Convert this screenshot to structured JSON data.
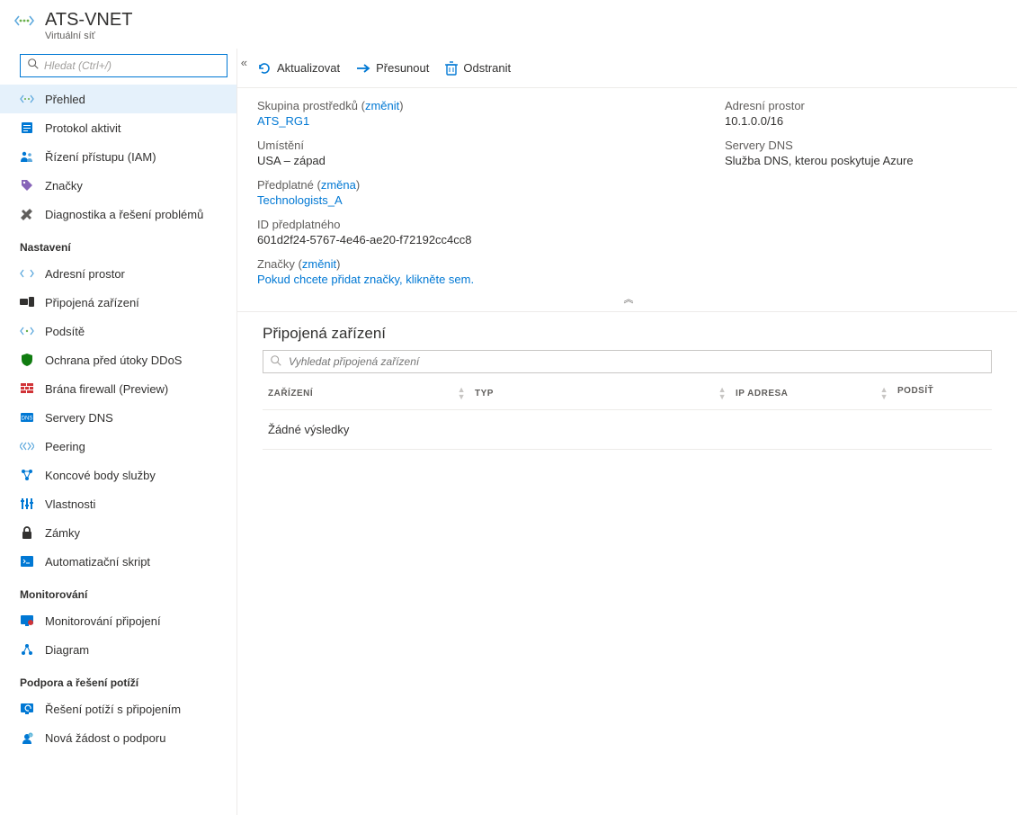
{
  "header": {
    "title": "ATS-VNET",
    "subtitle": "Virtuální síť"
  },
  "sidebar": {
    "search_placeholder": "Hledat (Ctrl+/)",
    "items_top": [
      {
        "label": "Přehled",
        "icon": "vnet"
      },
      {
        "label": "Protokol aktivit",
        "icon": "log"
      },
      {
        "label": "Řízení přístupu (IAM)",
        "icon": "iam"
      },
      {
        "label": "Značky",
        "icon": "tag"
      },
      {
        "label": "Diagnostika a řešení problémů",
        "icon": "diag"
      }
    ],
    "group_settings_label": "Nastavení",
    "items_settings": [
      {
        "label": "Adresní prostor",
        "icon": "addr"
      },
      {
        "label": "Připojená zařízení",
        "icon": "devices"
      },
      {
        "label": "Podsítě",
        "icon": "subnet"
      },
      {
        "label": "Ochrana před útoky DDoS",
        "icon": "shield"
      },
      {
        "label": "Brána firewall (Preview)",
        "icon": "firewall"
      },
      {
        "label": "Servery DNS",
        "icon": "dns"
      },
      {
        "label": "Peering",
        "icon": "peering"
      },
      {
        "label": "Koncové body služby",
        "icon": "endpoints"
      },
      {
        "label": "Vlastnosti",
        "icon": "props"
      },
      {
        "label": "Zámky",
        "icon": "lock"
      },
      {
        "label": "Automatizační skript",
        "icon": "script"
      }
    ],
    "group_monitor_label": "Monitorování",
    "items_monitor": [
      {
        "label": "Monitorování připojení",
        "icon": "monitor"
      },
      {
        "label": "Diagram",
        "icon": "diagram"
      }
    ],
    "group_support_label": "Podpora a řešení potíží",
    "items_support": [
      {
        "label": "Řešení potíží s připojením",
        "icon": "trouble"
      },
      {
        "label": "Nová žádost o podporu",
        "icon": "support"
      }
    ]
  },
  "toolbar": {
    "refresh": "Aktualizovat",
    "move": "Přesunout",
    "delete": "Odstranit"
  },
  "essentials": {
    "rg_label": "Skupina prostředků",
    "change1": "změnit",
    "rg_value": "ATS_RG1",
    "addr_label": "Adresní prostor",
    "addr_value": "10.1.0.0/16",
    "loc_label": "Umístění",
    "loc_value": "USA – západ",
    "dns_label": "Servery DNS",
    "dns_value": "Služba DNS, kterou poskytuje Azure",
    "sub_label": "Předplatné",
    "change2": "změna",
    "sub_value": "Technologists_A",
    "subid_label": "ID předplatného",
    "subid_value": "601d2f24-5767-4e46-ae20-f72192cc4cc8",
    "tags_label": "Značky",
    "change3": "změnit",
    "tags_value": "Pokud chcete přidat značky, klikněte sem."
  },
  "devices": {
    "heading": "Připojená zařízení",
    "search_placeholder": "Vyhledat připojená zařízení",
    "col_device": "ZAŘÍZENÍ",
    "col_type": "TYP",
    "col_ip": "IP ADRESA",
    "col_subnet": "PODSÍŤ",
    "empty": "Žádné výsledky"
  }
}
